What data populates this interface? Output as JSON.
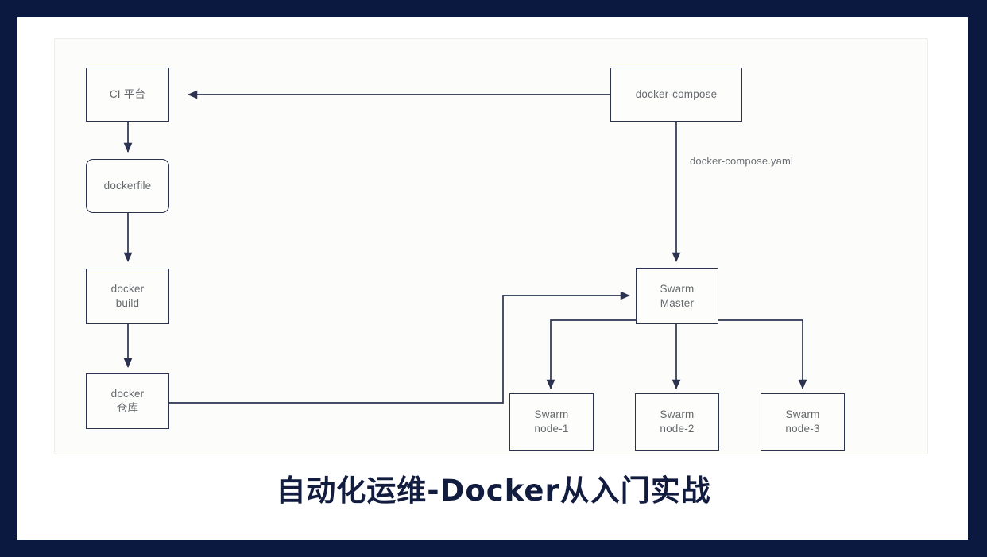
{
  "slide": {
    "title": "自动化运维-Docker从入门实战",
    "frame_color": "#0b1840",
    "panel_bg": "#fcfdfb",
    "node_border_color": "#2b3350",
    "node_text_color": "#666a6e",
    "title_color": "#111c3f"
  },
  "diagram": {
    "type": "flowchart",
    "nodes": [
      {
        "id": "ci",
        "label": "CI 平台",
        "shape": "rect"
      },
      {
        "id": "dockerfile",
        "label": "dockerfile",
        "shape": "rounded-rect"
      },
      {
        "id": "docker_build",
        "label": "docker\nbuild",
        "shape": "rect"
      },
      {
        "id": "docker_repo",
        "label": "docker\n仓库",
        "shape": "rect"
      },
      {
        "id": "docker_compose",
        "label": "docker-compose",
        "shape": "rect"
      },
      {
        "id": "swarm_master",
        "label": "Swarm\nMaster",
        "shape": "rect"
      },
      {
        "id": "swarm_node_1",
        "label": "Swarm\nnode-1",
        "shape": "rect"
      },
      {
        "id": "swarm_node_2",
        "label": "Swarm\nnode-2",
        "shape": "rect"
      },
      {
        "id": "swarm_node_3",
        "label": "Swarm\nnode-3",
        "shape": "rect"
      }
    ],
    "edges": [
      {
        "from": "docker_compose",
        "to": "ci",
        "label": ""
      },
      {
        "from": "ci",
        "to": "dockerfile",
        "label": ""
      },
      {
        "from": "dockerfile",
        "to": "docker_build",
        "label": ""
      },
      {
        "from": "docker_build",
        "to": "docker_repo",
        "label": ""
      },
      {
        "from": "docker_repo",
        "to": "swarm_master",
        "label": ""
      },
      {
        "from": "docker_compose",
        "to": "swarm_master",
        "label": "docker-compose.yaml"
      },
      {
        "from": "swarm_master",
        "to": "swarm_node_1",
        "label": ""
      },
      {
        "from": "swarm_master",
        "to": "swarm_node_2",
        "label": ""
      },
      {
        "from": "swarm_master",
        "to": "swarm_node_3",
        "label": ""
      }
    ],
    "edge_labels": {
      "compose_yaml": "docker-compose.yaml"
    }
  }
}
